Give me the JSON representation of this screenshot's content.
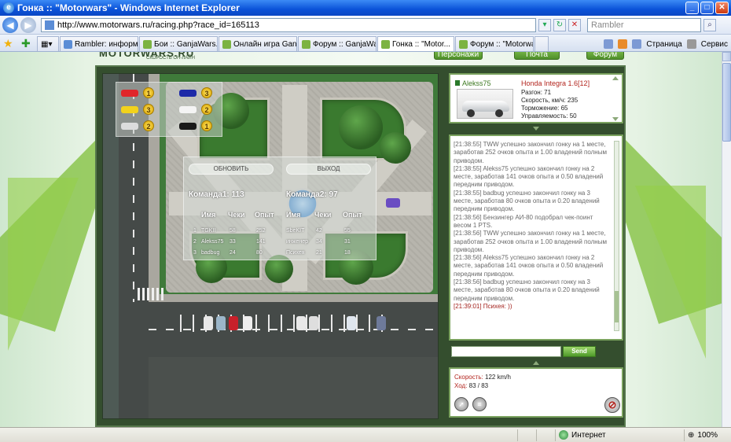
{
  "window": {
    "title": "Гонка :: \"Motorwars\" - Windows Internet Explorer"
  },
  "address": {
    "url": "http://www.motorwars.ru/racing.php?race_id=165113",
    "search_placeholder": "Rambler"
  },
  "tabs": [
    {
      "label": "Rambler: информац..."
    },
    {
      "label": "Бои :: GanjaWars.R..."
    },
    {
      "label": "Онлайн игра Ganja..."
    },
    {
      "label": "Форум :: GanjaWars..."
    },
    {
      "label": "Гонка :: \"Motor...",
      "active": true
    },
    {
      "label": "Форум :: \"Motorwars\""
    }
  ],
  "toolbar": {
    "page_label": "Страница",
    "service_label": "Сервис"
  },
  "site": {
    "logo": "MOTORWARS.RU",
    "logo_sub": "СКОРОСТЬ ОН-ЛАЙН",
    "nav": [
      "Персонажи",
      "Почта",
      "Форум"
    ]
  },
  "race": {
    "positions_left": [
      {
        "color": "#e0262a",
        "place": "1"
      },
      {
        "color": "#f2d21c",
        "place": "3"
      },
      {
        "color": "#dcdcdc",
        "place": "2"
      }
    ],
    "positions_right": [
      {
        "color": "#1d2aa8",
        "place": "3"
      },
      {
        "color": "#f4f4f4",
        "place": "2"
      },
      {
        "color": "#1a1a1a",
        "place": "1"
      }
    ],
    "score": {
      "btn_refresh": "ОБНОВИТЬ",
      "btn_exit": "ВЫХОД",
      "team1_title": "Команда1:  113",
      "team2_title": "Команда2:  97",
      "columns": [
        "Имя",
        "Чеки",
        "Опыт"
      ],
      "team1": [
        {
          "n": "1",
          "name": "TGKII",
          "checks": "58",
          "exp": "252"
        },
        {
          "n": "2",
          "name": "Alekss75",
          "checks": "33",
          "exp": "141"
        },
        {
          "n": "3",
          "name": "badbug",
          "checks": "24",
          "exp": "80"
        }
      ],
      "team2": [
        {
          "name": "SbeKIT",
          "checks": "42",
          "exp": "55"
        },
        {
          "name": "инженер",
          "checks": "34",
          "exp": "31"
        },
        {
          "name": "Психея",
          "checks": "21",
          "exp": "18"
        }
      ]
    }
  },
  "player_card": {
    "username": "Alekss75",
    "car_model": "Honda Integra 1.6[12]",
    "stats": [
      "Разгон: 71",
      "Скорость, км/ч: 235",
      "Торможение: 65",
      "Управляемость: 50"
    ]
  },
  "chat": {
    "messages": [
      {
        "text": "[21:38:55] TWW успешно закончил гонку на 1 месте, заработав 252 очков опыта и 1.00 владений полным приводом."
      },
      {
        "text": "[21:38:55] Alekss75 успешно закончил гонку на 2 месте, заработав 141 очков опыта и 0.50 владений передним приводом."
      },
      {
        "text": "[21:38:55] badbug успешно закончил гонку на 3 месте, заработав 80 очков опыта и 0.20 владений передним приводом."
      },
      {
        "text": "[21:38:56] Бензингер АИ-80 подобрал чек-поинт весом 1 PTS."
      },
      {
        "text": "[21:38:56] TWW успешно закончил гонку на 1 месте, заработав 252 очков опыта и 1.00 владений полным приводом."
      },
      {
        "text": "[21:38:56] Alekss75 успешно закончил гонку на 2 месте, заработав 141 очков опыта и 0.50 владений передним приводом."
      },
      {
        "text": "[21:38:56] badbug успешно закончил гонку на 3 месте, заработав 80 очков опыта и 0.20 владений передним приводом."
      },
      {
        "text": "[21:39:01] Психея: ))",
        "you": true
      }
    ],
    "send_label": "Send"
  },
  "speed": {
    "speed_label": "Скорость:",
    "speed_value": "122 km/h",
    "moves_label": "Ход:",
    "moves_value": "83 / 83"
  },
  "status": {
    "zone": "Интернет",
    "zoom": "100%"
  }
}
